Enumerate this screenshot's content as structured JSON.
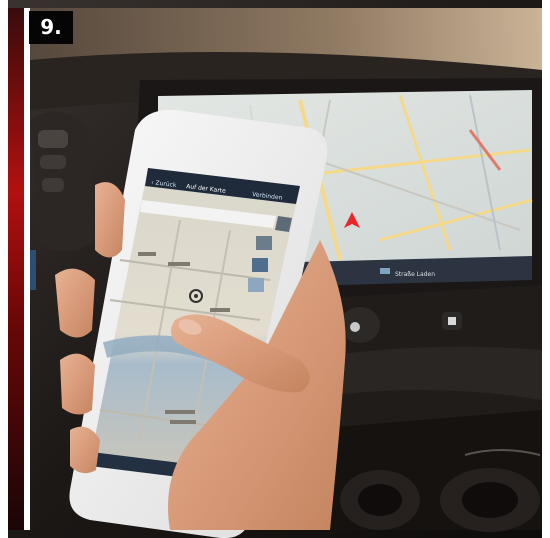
{
  "figure": {
    "number_label": "9.",
    "phone_header": {
      "back_label": "Zurück",
      "title": "Auf der Karte",
      "action_label": "Verbinden"
    },
    "dashboard_screen": {
      "status_text": "Straße Laden"
    },
    "colors": {
      "badge_bg": "#050505",
      "map_water": "#9fb7c9",
      "map_land": "#e8e6dc",
      "dashboard": "#141210",
      "nav_arrow": "#e8262b"
    }
  }
}
